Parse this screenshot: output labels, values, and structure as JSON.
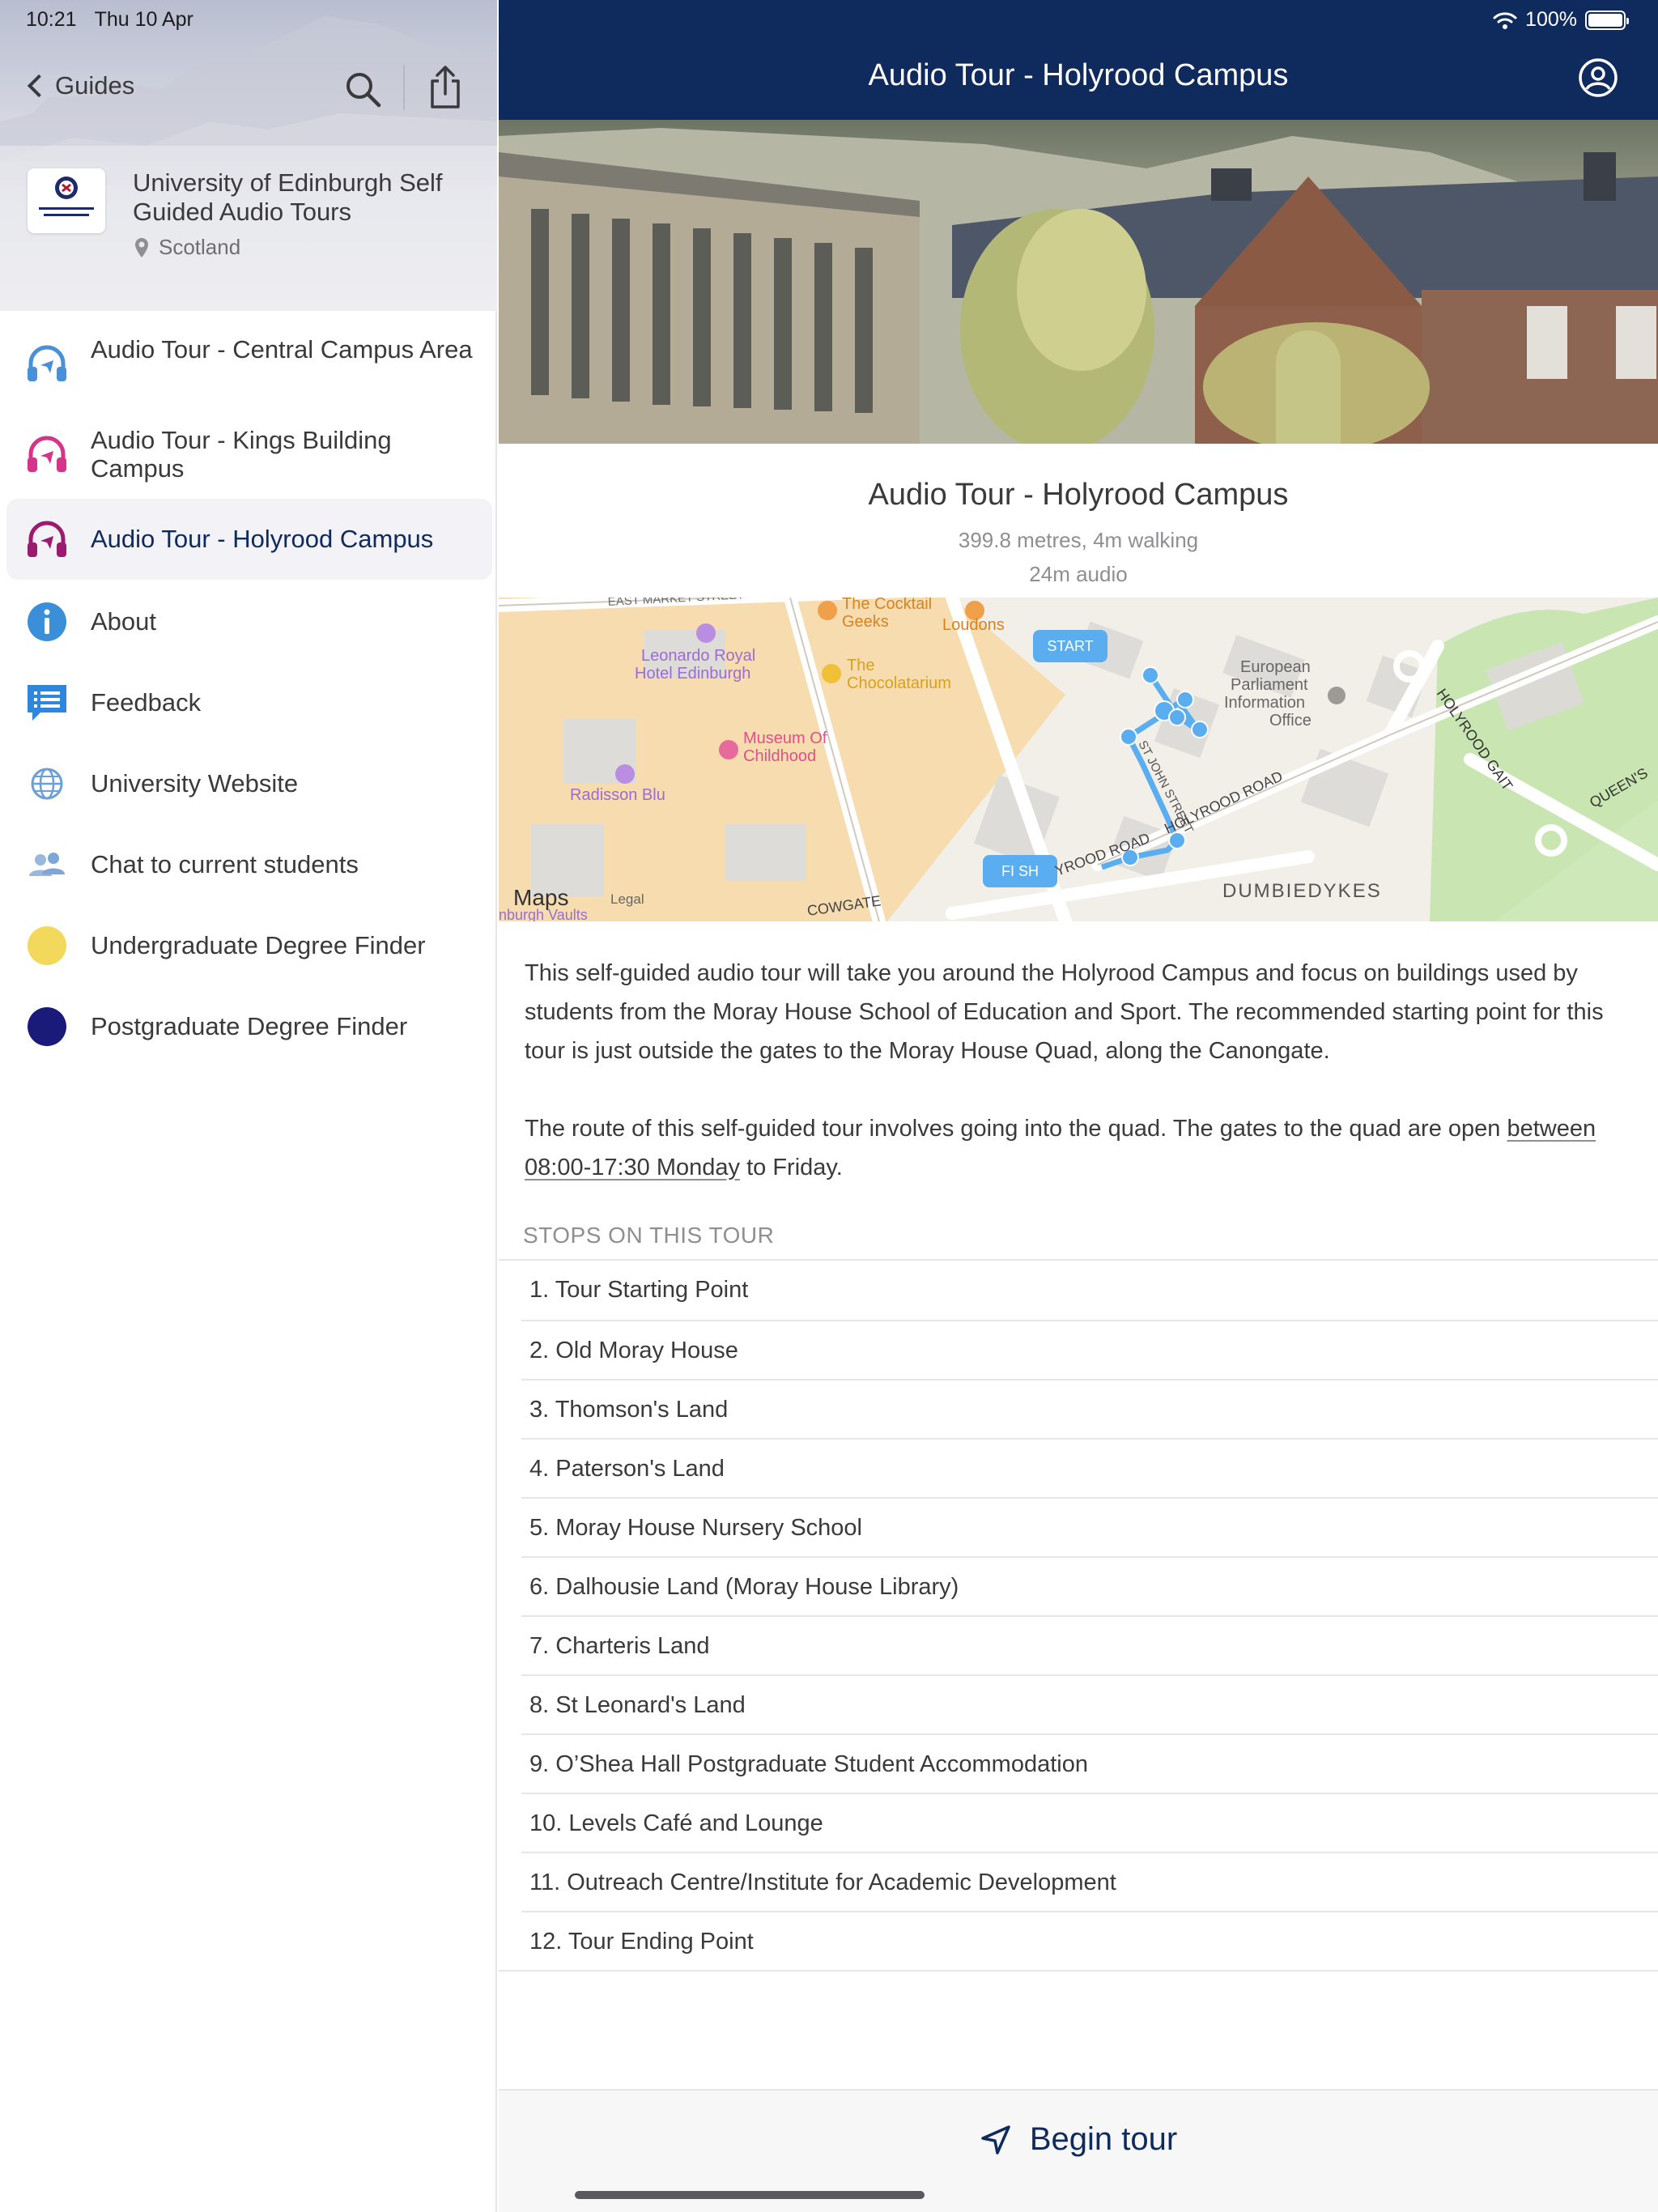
{
  "status_bar": {
    "time": "10:21",
    "date": "Thu 10 Apr",
    "battery": "100%",
    "battery_level": 1.0
  },
  "sidebar": {
    "back_label": "Guides",
    "guide_title": "University of Edinburgh Self Guided Audio Tours",
    "location": "Scotland",
    "logo_text": "THE UNIVERSITY of EDINBURGH",
    "items": [
      {
        "label": "Audio Tour - Central Campus Area",
        "icon": "headphones-icon",
        "color": "#4a90d9"
      },
      {
        "label": "Audio Tour - Kings Building Campus",
        "icon": "headphones-icon",
        "color": "#d6338a"
      },
      {
        "label": "Audio Tour - Holyrood Campus",
        "icon": "headphones-icon",
        "color": "#9b1b6e",
        "active": true
      },
      {
        "label": "About",
        "icon": "info-icon",
        "color": "#3b8fd8"
      },
      {
        "label": "Feedback",
        "icon": "feedback-icon",
        "color": "#2e86de"
      },
      {
        "label": "University Website",
        "icon": "globe-icon",
        "color": "#6a9fd8"
      },
      {
        "label": "Chat to current students",
        "icon": "people-icon",
        "color": "#7da7d9"
      },
      {
        "label": "Undergraduate Degree Finder",
        "icon": "yellow-dot-icon",
        "color": "#f2d95c"
      },
      {
        "label": "Postgraduate Degree Finder",
        "icon": "navy-dot-icon",
        "color": "#1a1a7a"
      }
    ]
  },
  "main": {
    "nav_title": "Audio Tour - Holyrood Campus",
    "tour_title": "Audio Tour - Holyrood Campus",
    "distance": "399.8 metres, 4m walking",
    "audio_length": "24m audio",
    "map": {
      "labels": {
        "east_market": "EAST MARKET STREET",
        "cocktail_geeks_1": "The Cocktail",
        "cocktail_geeks_2": "Geeks",
        "loudons": "Loudons",
        "leonardo_1": "Leonardo Royal",
        "leonardo_2": "Hotel Edinburgh",
        "chocolatarium_1": "The",
        "chocolatarium_2": "Chocolatarium",
        "museum_1": "Museum Of",
        "museum_2": "Childhood",
        "radisson": "Radisson Blu",
        "european_1": "European",
        "european_2": "Parliament",
        "european_3": "Information",
        "european_4": "Office",
        "holyrood_gait": "HOLYROOD GAIT",
        "queens": "QUEEN'S",
        "holyrood_road": "HOLYROOD ROAD",
        "holyrood_road_2": "YROOD ROAD",
        "st_john": "ST JOHN STREET",
        "dumbiedykes": "DUMBIEDYKES",
        "cowgate": "COWGATE",
        "maps": "Maps",
        "legal": "Legal",
        "vaults": "nburgh Vaults",
        "start": "START",
        "finish": "FI  SH"
      }
    },
    "description_1": "This self-guided audio tour will take you around the Holyrood Campus and focus on buildings used by students from the Moray House School of Education and Sport. The recommended starting point for this tour is just outside the gates to the Moray House Quad, along the Canongate.",
    "description_2_underlined": "between 08:00-17:30 Monday",
    "description_2_pre": "The route of this self-guided tour involves going into the quad. The gates to the quad are open ",
    "description_2_post": " to Friday.",
    "stops_header": "STOPS ON THIS TOUR",
    "stops": [
      "1. Tour Starting Point",
      "2. Old Moray House",
      "3. Thomson's Land",
      "4. Paterson's Land",
      "5. Moray House Nursery School",
      "6. Dalhousie Land (Moray House Library)",
      "7. Charteris Land",
      "8. St Leonard's Land",
      "9. O’Shea Hall Postgraduate Student Accommodation",
      "10. Levels Café and Lounge",
      "11. Outreach Centre/Institute for Academic Development",
      "12. Tour Ending Point"
    ],
    "begin_label": "Begin tour"
  },
  "colors": {
    "nav_bg": "#0f2a5c",
    "accent": "#0f2a5c",
    "route": "#5aaef0"
  }
}
